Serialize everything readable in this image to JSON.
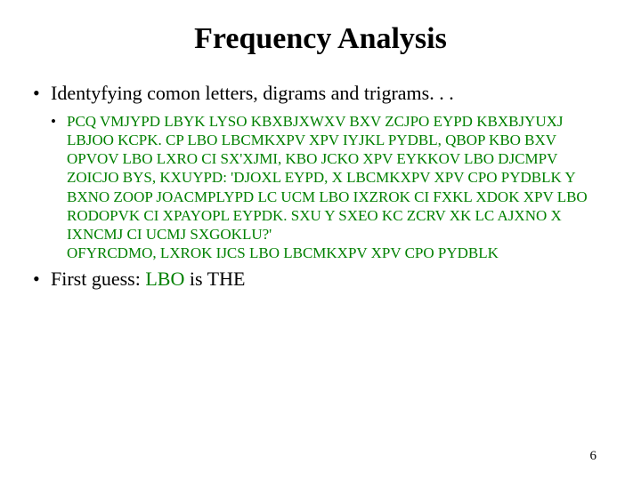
{
  "title": "Frequency Analysis",
  "page_number": "6",
  "bullets": {
    "intro": "Identyfying comon letters, digrams and trigrams. . .",
    "cipher_line1": "PCQ VMJYPD LBYK LYSO KBXBJXWXV BXV ZCJPO EYPD KBXBJYUXJ LBJOO KCPK.  CP LBO LBCMKXPV XPV IYJKL PYDBL, QBOP KBO BXV OPVOV LBO LXRO CI SX'XJMI, KBO JCKO XPV EYKKOV LBO DJCMPV ZOICJO BYS, KXUYPD: 'DJOXL EYPD, X LBCMKXPV XPV CPO PYDBLK Y BXNO ZOOP JOACMPLYPD LC UCM LBO IXZROK CI FXKL XDOK XPV LBO RODOPVK CI XPAYOPL EYPDK. SXU Y SXEO KC ZCRV XK LC AJXNO X IXNCMJ CI UCMJ SXGOKLU?'",
    "cipher_line2": "OFYRCDMO, LXROK IJCS LBO LBCMKXPV XPV CPO PYDBLK",
    "guess_plain_a": "First guess: ",
    "guess_cipher": "LBO",
    "guess_plain_b": " is ",
    "guess_answer": "THE"
  }
}
